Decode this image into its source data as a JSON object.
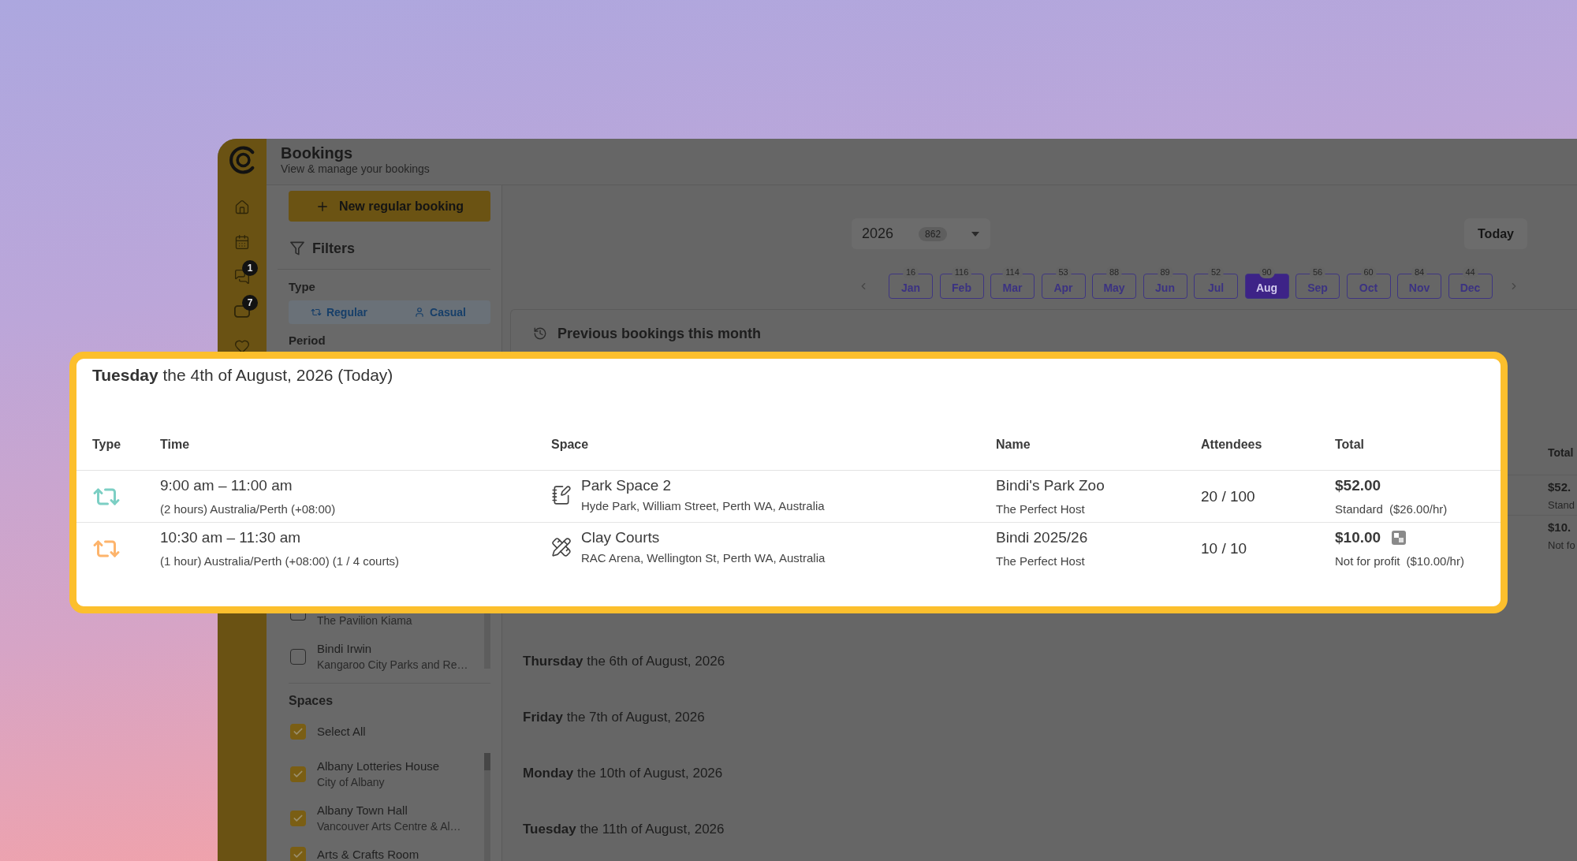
{
  "window": {
    "title": "Bookings",
    "subtitle": "View & manage your bookings"
  },
  "nav": [
    {
      "kind": "home"
    },
    {
      "kind": "calendar"
    },
    {
      "kind": "messages",
      "badge": "1"
    },
    {
      "kind": "inbox",
      "badge": "7"
    },
    {
      "kind": "favorites"
    }
  ],
  "sidebar": {
    "new_booking_button": "New regular booking",
    "filters_title": "Filters",
    "type_label": "Type",
    "type_options": [
      {
        "kind": "regular",
        "label": "Regular",
        "on": true
      },
      {
        "kind": "casual",
        "label": "Casual",
        "on": true
      }
    ],
    "period_label": "Period",
    "hosts": [
      {
        "subtitle": "The Pavilion Kiama",
        "checked": false
      },
      {
        "title": "Bindi Irwin",
        "subtitle": "Kangaroo City Parks and Re…",
        "checked": false
      }
    ],
    "spaces_label": "Spaces",
    "select_all": {
      "label": "Select All",
      "checked": true
    },
    "spaces": [
      {
        "title": "Albany Lotteries House",
        "subtitle": "City of Albany",
        "checked": true
      },
      {
        "title": "Albany Town Hall",
        "subtitle": "Vancouver Arts Centre & Al…",
        "checked": true
      },
      {
        "title": "Arts & Crafts Room",
        "checked": true
      }
    ]
  },
  "calendar": {
    "year": "2026",
    "year_count": "862",
    "today_button": "Today",
    "months": [
      {
        "label": "Jan",
        "count": "16",
        "selected": false
      },
      {
        "label": "Feb",
        "count": "116",
        "selected": false
      },
      {
        "label": "Mar",
        "count": "114",
        "selected": false
      },
      {
        "label": "Apr",
        "count": "53",
        "selected": false
      },
      {
        "label": "May",
        "count": "88",
        "selected": false
      },
      {
        "label": "Jun",
        "count": "89",
        "selected": false
      },
      {
        "label": "Jul",
        "count": "52",
        "selected": false
      },
      {
        "label": "Aug",
        "count": "90",
        "selected": true
      },
      {
        "label": "Sep",
        "count": "56",
        "selected": false
      },
      {
        "label": "Oct",
        "count": "60",
        "selected": false
      },
      {
        "label": "Nov",
        "count": "84",
        "selected": false
      },
      {
        "label": "Dec",
        "count": "44",
        "selected": false
      }
    ]
  },
  "previous_bookings": {
    "title": "Previous bookings this month",
    "column": "Total",
    "rows": [
      {
        "total": "$52.",
        "rate": "Stand"
      },
      {
        "total": "$10.",
        "rate": "Not fo"
      }
    ]
  },
  "highlight": {
    "date": "**Tuesday** the 4th of August, 2026 (Today)",
    "columns": [
      "Type",
      "Time",
      "Space",
      "Name",
      "Attendees",
      "Total"
    ],
    "rows": [
      {
        "color": "#7ccfc4",
        "time": "9:00 am – 11:00 am",
        "time_detail": "(2 hours) Australia/Perth (+08:00)",
        "space": {
          "kind": "area",
          "name": "Park Space 2",
          "address": "Hyde Park, William Street, Perth WA, Australia"
        },
        "name": "Bindi's Park Zoo",
        "host": "The Perfect Host",
        "attendees": "20 / 100",
        "total": "$52.00",
        "has_badge": false,
        "rate_type": "Standard",
        "rate": "($26.00/hr)"
      },
      {
        "color": "#fdb46c",
        "time": "10:30 am – 11:30 am",
        "time_detail": "(1 hour) Australia/Perth (+08:00) (1 / 4 courts)",
        "space": {
          "kind": "court",
          "name": "Clay Courts",
          "address": "RAC Arena, Wellington St, Perth WA, Australia"
        },
        "name": "Bindi 2025/26",
        "host": "The Perfect Host",
        "attendees": "10 / 10",
        "total": "$10.00",
        "has_badge": true,
        "rate_type": "Not for profit",
        "rate": "($10.00/hr)"
      }
    ]
  },
  "days": [
    "**Thursday** the 6th of August, 2026",
    "**Friday** the 7th of August, 2026",
    "**Monday** the 10th of August, 2026",
    "**Tuesday** the 11th of August, 2026"
  ]
}
